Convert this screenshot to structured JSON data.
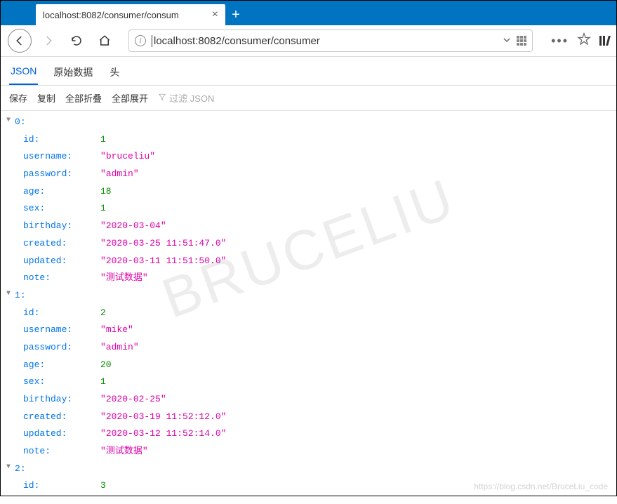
{
  "browser": {
    "tab_title": "localhost:8082/consumer/consum",
    "url": "localhost:8082/consumer/consumer"
  },
  "view_tabs": {
    "json": "JSON",
    "raw": "原始数据",
    "headers": "头"
  },
  "toolbar": {
    "save": "保存",
    "copy": "复制",
    "collapse_all": "全部折叠",
    "expand_all": "全部展开",
    "filter_placeholder": "过滤 JSON"
  },
  "json_data": [
    {
      "index": "0",
      "props": [
        {
          "key": "id",
          "val": "1",
          "type": "num"
        },
        {
          "key": "username",
          "val": "bruceliu",
          "type": "str"
        },
        {
          "key": "password",
          "val": "admin",
          "type": "str"
        },
        {
          "key": "age",
          "val": "18",
          "type": "num"
        },
        {
          "key": "sex",
          "val": "1",
          "type": "num"
        },
        {
          "key": "birthday",
          "val": "2020-03-04",
          "type": "str"
        },
        {
          "key": "created",
          "val": "2020-03-25 11:51:47.0",
          "type": "str"
        },
        {
          "key": "updated",
          "val": "2020-03-11 11:51:50.0",
          "type": "str"
        },
        {
          "key": "note",
          "val": "测试数据",
          "type": "str"
        }
      ]
    },
    {
      "index": "1",
      "props": [
        {
          "key": "id",
          "val": "2",
          "type": "num"
        },
        {
          "key": "username",
          "val": "mike",
          "type": "str"
        },
        {
          "key": "password",
          "val": "admin",
          "type": "str"
        },
        {
          "key": "age",
          "val": "20",
          "type": "num"
        },
        {
          "key": "sex",
          "val": "1",
          "type": "num"
        },
        {
          "key": "birthday",
          "val": "2020-02-25",
          "type": "str"
        },
        {
          "key": "created",
          "val": "2020-03-19 11:52:12.0",
          "type": "str"
        },
        {
          "key": "updated",
          "val": "2020-03-12 11:52:14.0",
          "type": "str"
        },
        {
          "key": "note",
          "val": "测试数据",
          "type": "str"
        }
      ]
    },
    {
      "index": "2",
      "props": [
        {
          "key": "id",
          "val": "3",
          "type": "num"
        }
      ]
    }
  ],
  "watermark": "BRUCELIU",
  "footer_watermark": "https://blog.csdn.net/BruceLiu_code"
}
